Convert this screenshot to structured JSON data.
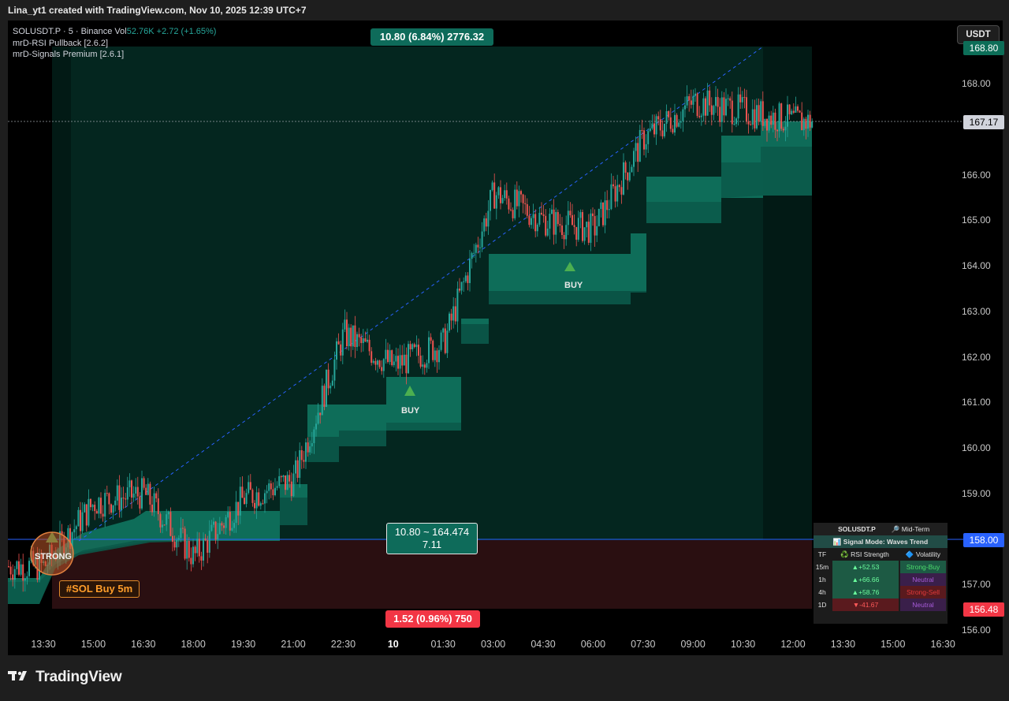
{
  "header": {
    "attribution": "Lina_yt1 created with TradingView.com, Nov 10, 2025 12:39 UTC+7"
  },
  "legend": {
    "symbol_line": "SOLUSDT.P · 5 · Binance  Vol",
    "volume": "52.76K",
    "change": "+2.72 (+1.65%)",
    "indicator_1": "mrD-RSI Pullback [2.6.2]",
    "indicator_2": "mrD-Signals Premium [2.6.1]"
  },
  "currency_button": "USDT",
  "price_axis": {
    "ticks": [
      "168.00",
      "166.00",
      "165.00",
      "164.00",
      "163.00",
      "162.00",
      "161.00",
      "160.00",
      "159.00",
      "157.00",
      "156.00"
    ],
    "tags": {
      "top": "168.80",
      "current": "167.17",
      "entry": "158.00",
      "stop": "156.48"
    }
  },
  "time_axis": {
    "labels": [
      "13:30",
      "15:00",
      "16:30",
      "18:00",
      "19:30",
      "21:00",
      "22:30",
      "10",
      "01:30",
      "03:00",
      "04:30",
      "06:00",
      "07:30",
      "09:00",
      "10:30",
      "12:00",
      "13:30",
      "15:00",
      "16:30"
    ]
  },
  "position": {
    "target_label": "10.80 (6.84%) 2776.32",
    "mid_label_line1": "10.80 ~ 164.474",
    "mid_label_line2": "7.11",
    "stop_label": "1.52 (0.96%) 750"
  },
  "signals": {
    "strong": "STRONG",
    "buy_1": "BUY",
    "buy_2": "BUY",
    "hashtag": "#SOL Buy 5m"
  },
  "signal_table": {
    "title": "SOLUSDT.P",
    "term": "🔎 Mid-Term",
    "mode": "📊 Signal Mode: Waves Trend",
    "headers": [
      "TF",
      "♻️ RSI Strength",
      "🔷 Volatility"
    ],
    "rows": [
      {
        "tf": "15m",
        "rsi": "▲+52.53",
        "vol": "Strong-Buy"
      },
      {
        "tf": "1h",
        "rsi": "▲+66.66",
        "vol": "Neutral"
      },
      {
        "tf": "4h",
        "rsi": "▲+58.76",
        "vol": "Strong-Sell"
      },
      {
        "tf": "1D",
        "rsi": "▼-41.67",
        "vol": "Neutral"
      }
    ]
  },
  "colors": {
    "up": "#26a69a",
    "down": "#ef5350",
    "band": "#1c8f78",
    "target_zone": "#04261f",
    "stop_zone": "#2a0f11",
    "entry_line": "#2962ff",
    "badge_green": "#0e6b5a",
    "badge_red": "#f23645"
  },
  "brand": "TradingView",
  "chart_data": {
    "type": "candlestick",
    "symbol": "SOLUSDT.P",
    "interval": "5",
    "exchange": "Binance",
    "ylim": [
      156.0,
      168.9
    ],
    "x_labels": [
      "13:30",
      "15:00",
      "16:30",
      "18:00",
      "19:30",
      "21:00",
      "22:30",
      "10",
      "01:30",
      "03:00",
      "04:30",
      "06:00",
      "07:30",
      "09:00",
      "10:30",
      "12:00"
    ],
    "approx_close_path": [
      [
        "13:30",
        157.4
      ],
      [
        "15:00",
        158.8
      ],
      [
        "16:30",
        159.0
      ],
      [
        "18:00",
        157.6
      ],
      [
        "19:30",
        158.9
      ],
      [
        "21:00",
        159.3
      ],
      [
        "22:30",
        162.5
      ],
      [
        "10",
        161.8
      ],
      [
        "01:30",
        162.3
      ],
      [
        "03:00",
        165.6
      ],
      [
        "04:30",
        165.0
      ],
      [
        "06:00",
        164.8
      ],
      [
        "07:30",
        166.8
      ],
      [
        "09:00",
        167.6
      ],
      [
        "10:30",
        167.4
      ],
      [
        "12:00",
        167.17
      ]
    ],
    "entry_price": 158.0,
    "target_price": 168.8,
    "stop_price": 156.48,
    "current_price": 167.17
  }
}
